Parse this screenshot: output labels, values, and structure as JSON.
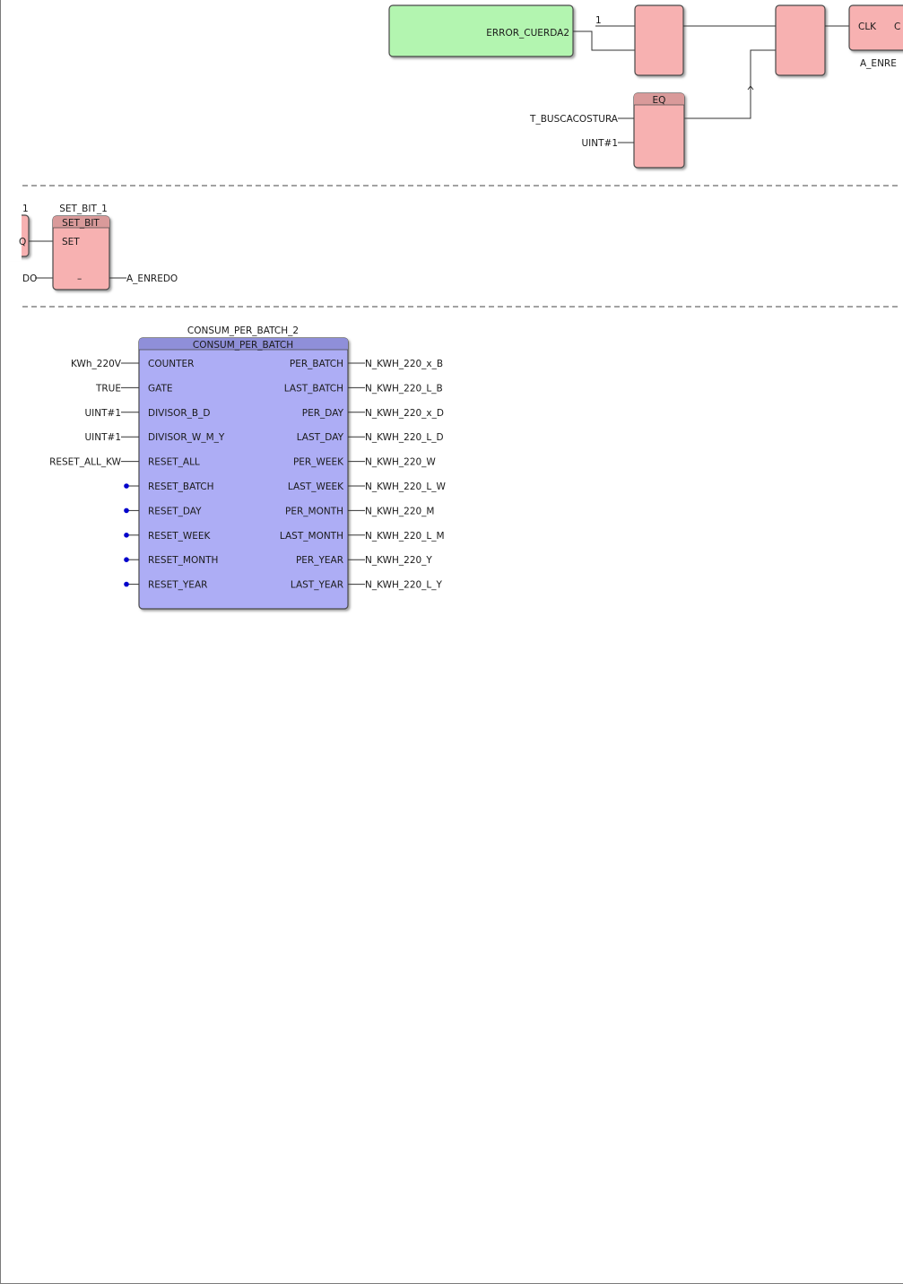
{
  "network1": {
    "error_input_label": "ERROR_CUERDA2",
    "const_one": "1",
    "clk_pin": "CLK",
    "clk_right_partial": "C",
    "a_enredo_partial": "A_ENRE",
    "eq_block_type": "EQ",
    "eq_in1": "T_BUSCACOSTURA",
    "eq_in2": "UINT#1"
  },
  "network2": {
    "left_const": "1",
    "left_partial_pin": "Q",
    "left_partial_wire": "DO",
    "instance_name": "SET_BIT_1",
    "block_type": "SET_BIT",
    "pin_set": "SET",
    "pin_dash": "–",
    "output_var": "A_ENREDO"
  },
  "network3": {
    "instance_name": "CONSUM_PER_BATCH_2",
    "block_type": "CONSUM_PER_BATCH",
    "inputs": [
      {
        "var": "KWh_220V",
        "pin": "COUNTER",
        "connected": true
      },
      {
        "var": "TRUE",
        "pin": "GATE",
        "connected": true
      },
      {
        "var": "UINT#1",
        "pin": "DIVISOR_B_D",
        "connected": true
      },
      {
        "var": "UINT#1",
        "pin": "DIVISOR_W_M_Y",
        "connected": true
      },
      {
        "var": "RESET_ALL_KW",
        "pin": "RESET_ALL",
        "connected": true
      },
      {
        "var": "",
        "pin": "RESET_BATCH",
        "connected": false
      },
      {
        "var": "",
        "pin": "RESET_DAY",
        "connected": false
      },
      {
        "var": "",
        "pin": "RESET_WEEK",
        "connected": false
      },
      {
        "var": "",
        "pin": "RESET_MONTH",
        "connected": false
      },
      {
        "var": "",
        "pin": "RESET_YEAR",
        "connected": false
      }
    ],
    "outputs": [
      {
        "pin": "PER_BATCH",
        "var": "N_KWH_220_x_B"
      },
      {
        "pin": "LAST_BATCH",
        "var": "N_KWH_220_L_B"
      },
      {
        "pin": "PER_DAY",
        "var": "N_KWH_220_x_D"
      },
      {
        "pin": "LAST_DAY",
        "var": "N_KWH_220_L_D"
      },
      {
        "pin": "PER_WEEK",
        "var": "N_KWH_220_W"
      },
      {
        "pin": "LAST_WEEK",
        "var": "N_KWH_220_L_W"
      },
      {
        "pin": "PER_MONTH",
        "var": "N_KWH_220_M"
      },
      {
        "pin": "LAST_MONTH",
        "var": "N_KWH_220_L_M"
      },
      {
        "pin": "PER_YEAR",
        "var": "N_KWH_220_Y"
      },
      {
        "pin": "LAST_YEAR",
        "var": "N_KWH_220_L_Y"
      }
    ]
  },
  "colors": {
    "green_block": "#b3f5b0",
    "red_block": "#f7b1b1",
    "red_header": "#d99a9a",
    "blue_block": "#adadf5",
    "blue_header": "#8f8fd9",
    "unconnected_dot": "#0000cc"
  }
}
